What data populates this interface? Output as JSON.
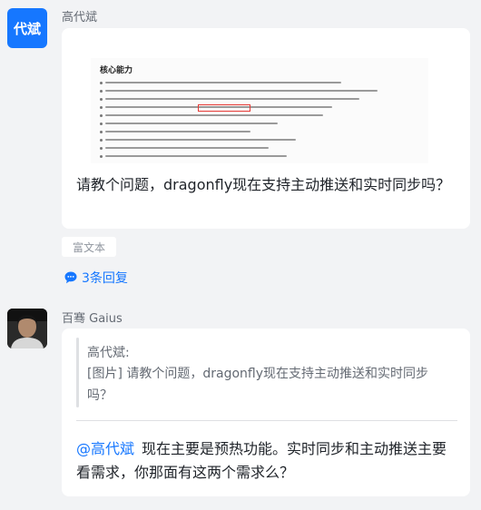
{
  "message1": {
    "avatar_text": "代斌",
    "author": "高代斌",
    "doc_title": "核心能力",
    "question": "请教个问题，dragonfly现在支持主动推送和实时同步吗？",
    "tag": "富文本",
    "reply_icon": "speech-bubble-icon",
    "reply_link": "3条回复"
  },
  "message2": {
    "author": "百骞 Gaius",
    "quote_author": "高代斌:",
    "quote_text": "[图片] 请教个问题，dragonfly现在支持主动推送和实时同步吗？",
    "mention": "@高代斌",
    "answer": "现在主要是预热功能。实时同步和主动推送主要看需求，你那面有这两个需求么？"
  },
  "colors": {
    "accent": "#1677ff",
    "background": "#f2f3f5"
  }
}
